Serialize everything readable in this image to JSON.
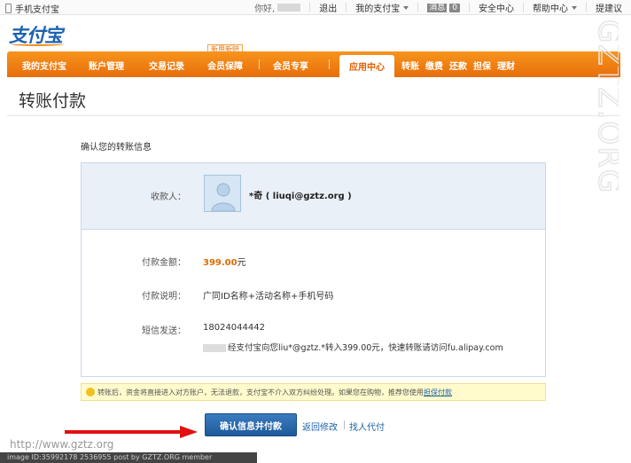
{
  "topbar": {
    "mobile_label": "手机支付宝",
    "greeting": "你好,",
    "logout": "退出",
    "my_alipay": "我的支付宝",
    "messages_label": "消息",
    "messages_count": "0",
    "security": "安全中心",
    "help": "帮助中心",
    "feedback": "提建议"
  },
  "logo": {
    "text": "支付宝"
  },
  "nav": {
    "items": [
      "我的支付宝",
      "账户管理",
      "交易记录",
      "会员保障",
      "会员专享",
      "应用中心"
    ],
    "promo_badge": "新用新赔",
    "sub_items": [
      "转账",
      "缴费",
      "还款",
      "担保",
      "理财"
    ]
  },
  "page": {
    "title": "转账付款",
    "section_title": "确认您的转账信息"
  },
  "confirm": {
    "payee_label": "收款人：",
    "payee_name": "*奇 ( liuqi@gztz.org )",
    "amount_label": "付款金额：",
    "amount_value": "399.00",
    "amount_unit": "元",
    "desc_label": "付款说明：",
    "desc_value": "广同ID名称+活动名称+手机号码",
    "sms_label": "短信发送：",
    "sms_phone": "18024044442",
    "sms_text": "经支付宝向您liu*@gztz.*转入399.00元，快速转账请访问fu.alipay.com"
  },
  "notice": {
    "text": "转账后，资金将直接进入对方账户，无法退款，支付宝不介入双方纠纷处理。如果您在购物，推荐您使用",
    "link": "担保付款"
  },
  "actions": {
    "confirm_button": "确认信息并付款",
    "back_link": "返回修改",
    "proxy_link": "找人代付"
  },
  "watermark": {
    "side_text": "GZTZ.ORG",
    "url": "http://www.gztz.org",
    "caption": "image ID:35992178 2536955 post by GZTZ.ORG member"
  },
  "colors": {
    "nav_orange": "#f08012",
    "link_blue": "#1d62a8",
    "amount_orange": "#e06b00",
    "button_blue": "#2a6aad"
  }
}
